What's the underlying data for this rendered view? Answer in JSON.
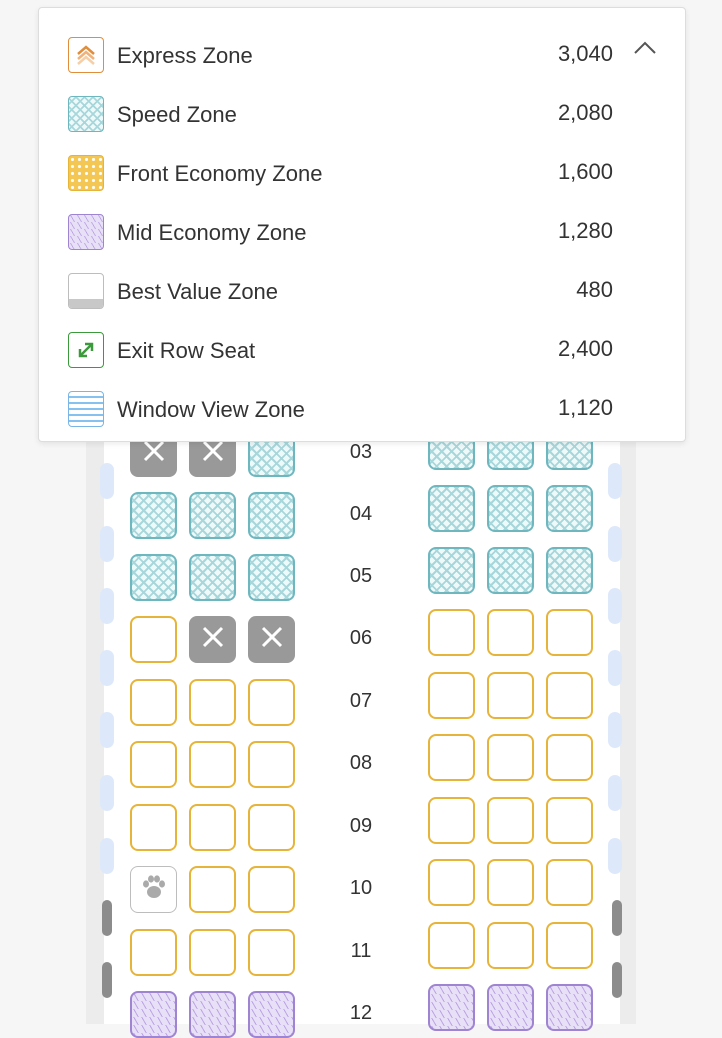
{
  "legend": {
    "zones": [
      {
        "name": "Express Zone",
        "value": "3,040",
        "icon": "express-icon"
      },
      {
        "name": "Speed Zone",
        "value": "2,080",
        "icon": "speed-zone-icon"
      },
      {
        "name": "Front Economy Zone",
        "value": "1,600",
        "icon": "front-economy-icon"
      },
      {
        "name": "Mid Economy Zone",
        "value": "1,280",
        "icon": "mid-economy-icon"
      },
      {
        "name": "Best Value Zone",
        "value": "480",
        "icon": "best-value-icon"
      },
      {
        "name": "Exit Row Seat",
        "value": "2,400",
        "icon": "exit-row-icon"
      },
      {
        "name": "Window View Zone",
        "value": "1,120",
        "icon": "window-view-icon"
      }
    ],
    "collapse_icon": "chevron-up-icon"
  },
  "rows": [
    {
      "number": "03",
      "left": [
        "taken",
        "taken",
        "speed"
      ],
      "right": [
        "speed",
        "speed",
        "speed"
      ]
    },
    {
      "number": "04",
      "left": [
        "speed",
        "speed",
        "speed"
      ],
      "right": [
        "speed",
        "speed",
        "speed"
      ]
    },
    {
      "number": "05",
      "left": [
        "speed",
        "speed",
        "speed"
      ],
      "right": [
        "speed",
        "speed",
        "speed"
      ]
    },
    {
      "number": "06",
      "left": [
        "front",
        "taken",
        "taken"
      ],
      "right": [
        "front",
        "front",
        "front"
      ]
    },
    {
      "number": "07",
      "left": [
        "front",
        "front",
        "front"
      ],
      "right": [
        "front",
        "front",
        "front"
      ]
    },
    {
      "number": "08",
      "left": [
        "front",
        "front",
        "front"
      ],
      "right": [
        "front",
        "front",
        "front"
      ]
    },
    {
      "number": "09",
      "left": [
        "front",
        "front",
        "front"
      ],
      "right": [
        "front",
        "front",
        "front"
      ]
    },
    {
      "number": "10",
      "left": [
        "pet",
        "front",
        "front"
      ],
      "right": [
        "front",
        "front",
        "front"
      ]
    },
    {
      "number": "11",
      "left": [
        "front",
        "front",
        "front"
      ],
      "right": [
        "front",
        "front",
        "front"
      ]
    },
    {
      "number": "12",
      "left": [
        "mid",
        "mid",
        "mid"
      ],
      "right": [
        "mid",
        "mid",
        "mid"
      ]
    }
  ],
  "colors": {
    "speed": "#6fb7bf",
    "front_economy": "#e7b43a",
    "mid_economy": "#9f84d2",
    "taken": "#999999",
    "exit": "#3c9a3c",
    "express": "#e08e3c",
    "window": "#79b6e6"
  }
}
